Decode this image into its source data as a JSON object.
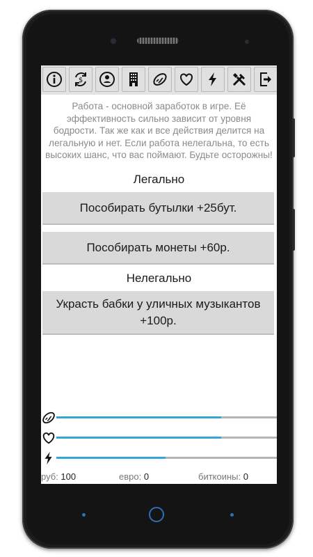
{
  "toolbar": {
    "items": [
      {
        "icon": "info-icon"
      },
      {
        "icon": "exchange-icon"
      },
      {
        "icon": "person-icon"
      },
      {
        "icon": "building-icon"
      },
      {
        "icon": "food-icon"
      },
      {
        "icon": "heart-icon"
      },
      {
        "icon": "lightning-icon"
      },
      {
        "icon": "tools-icon"
      },
      {
        "icon": "exit-icon"
      }
    ]
  },
  "description": "Работа - основной заработок в игре. Её эффективность сильно зависит от уровня бодрости. Так же как и все действия делится на легальную и нет. Если работа нелегальна, то есть высоких шанс, что вас поймают. Будьте осторожны!",
  "legal": {
    "title": "Легально",
    "buttons": [
      {
        "label": "Пособирать бутылки +25бут."
      },
      {
        "label": "Пособирать монеты +60р."
      }
    ]
  },
  "illegal": {
    "title": "Нелегально",
    "buttons": [
      {
        "label": "Украсть бабки у уличных музыкантов +100р."
      }
    ]
  },
  "stats": {
    "food": {
      "icon": "food-icon",
      "level": 0.74
    },
    "health": {
      "icon": "heart-icon",
      "level": 0.74
    },
    "energy": {
      "icon": "lightning-icon",
      "level": 0.49
    }
  },
  "currency": {
    "rub_label": "руб:",
    "rub_value": "100",
    "euro_label": "евро:",
    "euro_value": "0",
    "btc_label": "биткоины:",
    "btc_value": "0"
  },
  "colors": {
    "bar_fill": "#32a6d8",
    "bar_track": "#b5b5b5",
    "button_bg": "#d9d9d9",
    "nav_accent": "#2e6fb5"
  }
}
